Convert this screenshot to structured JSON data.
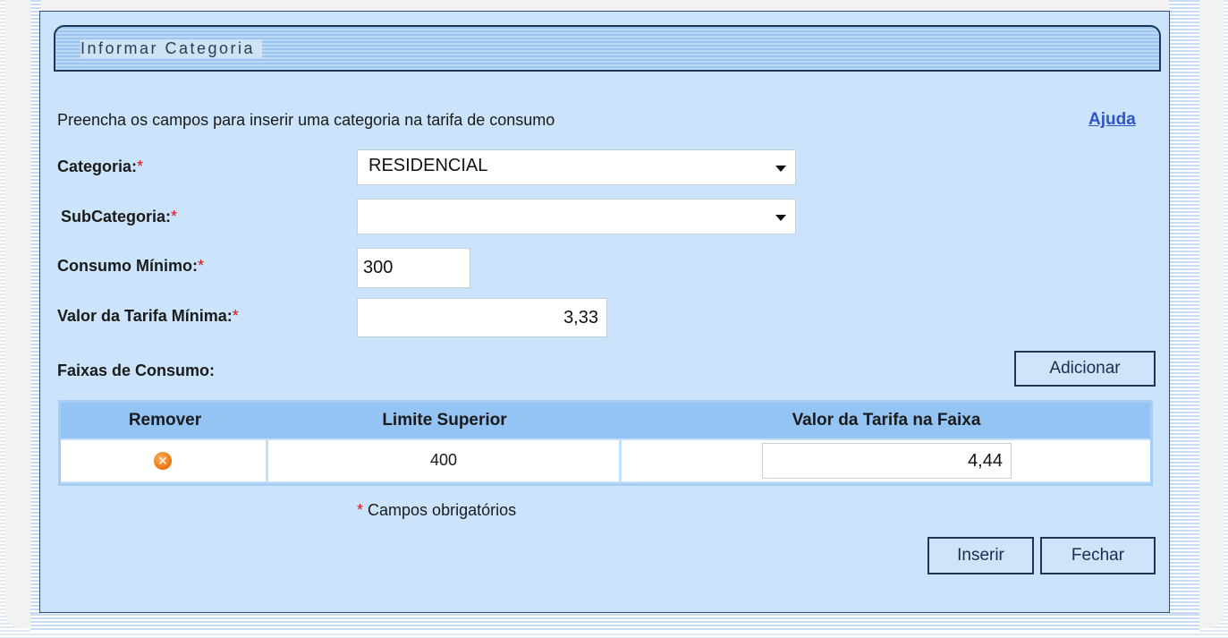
{
  "panel": {
    "title": "Informar Categoria",
    "instructions": "Preencha os campos para inserir uma categoria na tarifa de consumo",
    "help_label": "Ajuda"
  },
  "form": {
    "required_marker": "*",
    "categoria": {
      "label": "Categoria:",
      "value": "RESIDENCIAL"
    },
    "subcategoria": {
      "label": "SubCategoria:",
      "value": ""
    },
    "consumo_minimo": {
      "label": "Consumo Mínimo:",
      "value": "300"
    },
    "valor_tarifa_minima": {
      "label": "Valor da Tarifa Mínima:",
      "value": "3,33"
    },
    "faixas_label": "Faixas de Consumo:",
    "adicionar_label": "Adicionar"
  },
  "faixas_table": {
    "headers": [
      "Remover",
      "Limite Superior",
      "Valor da Tarifa na Faixa"
    ],
    "rows": [
      {
        "remove_icon": "remove-x-icon",
        "limite_superior": "400",
        "valor_tarifa": "4,44"
      }
    ]
  },
  "footer": {
    "required_note": "Campos obrigatórios",
    "inserir_label": "Inserir",
    "fechar_label": "Fechar"
  },
  "colors": {
    "panel_bg": "#cbe4fb",
    "header_bg": "#93c4f3",
    "link": "#2f56c9",
    "required": "#dd1111",
    "remove_icon": "#f0801a"
  }
}
